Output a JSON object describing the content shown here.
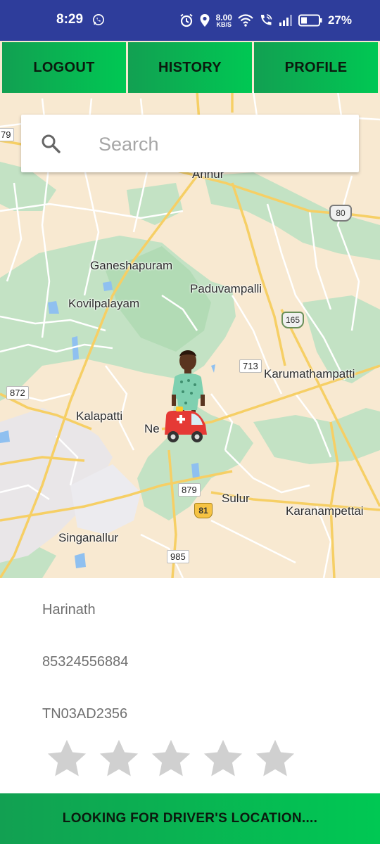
{
  "status_bar": {
    "time": "8:29",
    "net_speed_value": "8.00",
    "net_speed_unit": "KB/S",
    "battery_percent": "27%"
  },
  "nav": {
    "logout_label": "LOGOUT",
    "history_label": "HISTORY",
    "profile_label": "PROFILE"
  },
  "search": {
    "placeholder": "Search",
    "value": ""
  },
  "map": {
    "places": {
      "annur": "Annur",
      "ganeshapuram": "Ganeshapuram",
      "paduvampalli": "Paduvampalli",
      "kovilpalayam": "Kovilpalayam",
      "karumathampatti": "Karumathampatti",
      "kalapatti": "Kalapatti",
      "neelambur": "Ne",
      "sulur": "Sulur",
      "karanampettai": "Karanampettai",
      "singanallur": "Singanallur"
    },
    "roads": {
      "r79": "79",
      "r80": "80",
      "r165": "165",
      "r713": "713",
      "r872": "872",
      "r879": "879",
      "r81": "81",
      "r985": "985"
    }
  },
  "driver": {
    "name": "Harinath",
    "phone": "85324556884",
    "vehicle_number": "TN03AD2356",
    "rating": 0,
    "rating_max": 5
  },
  "status_message": "LOOKING FOR DRIVER'S LOCATION....",
  "colors": {
    "status_bar": "#2e3d9b",
    "button_green_start": "#12a052",
    "button_green_end": "#00c853",
    "star_empty": "#d0d0d0"
  }
}
